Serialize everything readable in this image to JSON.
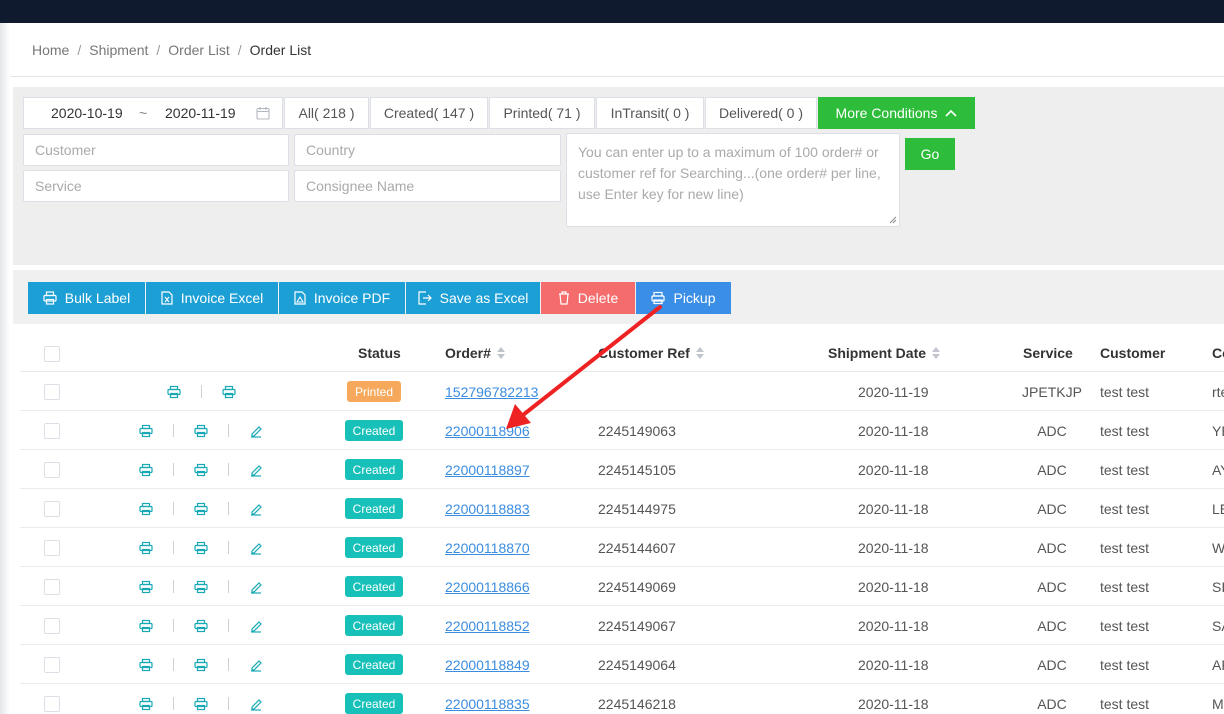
{
  "breadcrumb": [
    "Home",
    "Shipment",
    "Order List",
    "Order List"
  ],
  "date_range": {
    "start": "2020-10-19",
    "separator": "~",
    "end": "2020-11-19"
  },
  "status_tabs": [
    {
      "label": "All( 218 )"
    },
    {
      "label": "Created( 147 )"
    },
    {
      "label": "Printed( 71 )"
    },
    {
      "label": "InTransit( 0 )"
    },
    {
      "label": "Delivered( 0 )"
    }
  ],
  "more_conditions": "More Conditions",
  "filters": {
    "customer_placeholder": "Customer",
    "country_placeholder": "Country",
    "service_placeholder": "Service",
    "consignee_placeholder": "Consignee Name",
    "search_placeholder": "You can enter up to a maximum of 100 order# or customer ref for Searching...(one order# per line, use Enter key for new line)",
    "go_label": "Go"
  },
  "toolbar": {
    "bulk_label": "Bulk Label",
    "invoice_excel": "Invoice Excel",
    "invoice_pdf": "Invoice PDF",
    "save_excel": "Save as Excel",
    "delete": "Delete",
    "pickup": "Pickup"
  },
  "columns": {
    "status": "Status",
    "order": "Order#",
    "customer_ref": "Customer Ref",
    "shipment_date": "Shipment Date",
    "service": "Service",
    "customer": "Customer",
    "consignee": "Co"
  },
  "rows": [
    {
      "status": "Printed",
      "order": "152796782213",
      "ref": "",
      "date": "2020-11-19",
      "service": "JPETKJP",
      "customer": "test test",
      "consignee": "rte"
    },
    {
      "status": "Created",
      "order": "22000118906",
      "ref": "2245149063",
      "date": "2020-11-18",
      "service": "ADC",
      "customer": "test test",
      "consignee": "YE"
    },
    {
      "status": "Created",
      "order": "22000118897",
      "ref": "2245145105",
      "date": "2020-11-18",
      "service": "ADC",
      "customer": "test test",
      "consignee": "AY"
    },
    {
      "status": "Created",
      "order": "22000118883",
      "ref": "2245144975",
      "date": "2020-11-18",
      "service": "ADC",
      "customer": "test test",
      "consignee": "LE"
    },
    {
      "status": "Created",
      "order": "22000118870",
      "ref": "2245144607",
      "date": "2020-11-18",
      "service": "ADC",
      "customer": "test test",
      "consignee": "W"
    },
    {
      "status": "Created",
      "order": "22000118866",
      "ref": "2245149069",
      "date": "2020-11-18",
      "service": "ADC",
      "customer": "test test",
      "consignee": "SI"
    },
    {
      "status": "Created",
      "order": "22000118852",
      "ref": "2245149067",
      "date": "2020-11-18",
      "service": "ADC",
      "customer": "test test",
      "consignee": "SA"
    },
    {
      "status": "Created",
      "order": "22000118849",
      "ref": "2245149064",
      "date": "2020-11-18",
      "service": "ADC",
      "customer": "test test",
      "consignee": "AF"
    },
    {
      "status": "Created",
      "order": "22000118835",
      "ref": "2245146218",
      "date": "2020-11-18",
      "service": "ADC",
      "customer": "test test",
      "consignee": "M"
    }
  ],
  "colors": {
    "topbar": "#0f1a2e",
    "green": "#2ebd3a",
    "toolbar_blue": "#1b9fd4",
    "delete_red": "#f56c6c",
    "pickup_blue": "#3a8ee6",
    "badge_created": "#17c0b8",
    "badge_printed": "#f6a95c",
    "annotation_arrow": "#ee2222"
  }
}
